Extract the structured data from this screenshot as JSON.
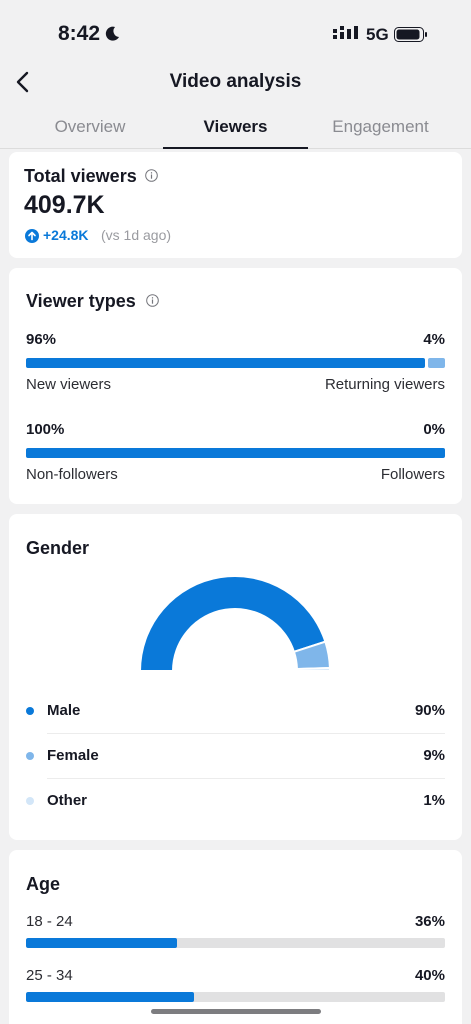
{
  "status": {
    "time": "8:42",
    "network": "5G"
  },
  "header": {
    "title": "Video analysis"
  },
  "tabs": [
    "Overview",
    "Viewers",
    "Engagement"
  ],
  "total_viewers": {
    "title": "Total viewers",
    "value": "409.7K",
    "delta": "+24.8K",
    "delta_note": "(vs 1d ago)"
  },
  "viewer_types": {
    "title": "Viewer types",
    "rows": [
      {
        "left_pct": "96%",
        "right_pct": "4%",
        "left_label": "New viewers",
        "right_label": "Returning viewers",
        "left_value": 96
      },
      {
        "left_pct": "100%",
        "right_pct": "0%",
        "left_label": "Non-followers",
        "right_label": "Followers",
        "left_value": 100
      }
    ]
  },
  "gender": {
    "title": "Gender",
    "items": [
      {
        "name": "Male",
        "value": "90%",
        "color": "#0a79d9"
      },
      {
        "name": "Female",
        "value": "9%",
        "color": "#7fb6ea"
      },
      {
        "name": "Other",
        "value": "1%",
        "color": "#d3e6f8"
      }
    ]
  },
  "chart_data": {
    "type": "pie",
    "title": "Gender",
    "categories": [
      "Male",
      "Female",
      "Other"
    ],
    "values": [
      90,
      9,
      1
    ],
    "colors": [
      "#0a79d9",
      "#7fb6ea",
      "#d3e6f8"
    ]
  },
  "age": {
    "title": "Age",
    "rows": [
      {
        "range": "18 - 24",
        "pct": "36%",
        "value": 36
      },
      {
        "range": "25 - 34",
        "pct": "40%",
        "value": 40
      }
    ]
  },
  "colors": {
    "accent": "#0a79d9",
    "accent_light": "#7fb6ea",
    "track": "#e1e1e2"
  }
}
